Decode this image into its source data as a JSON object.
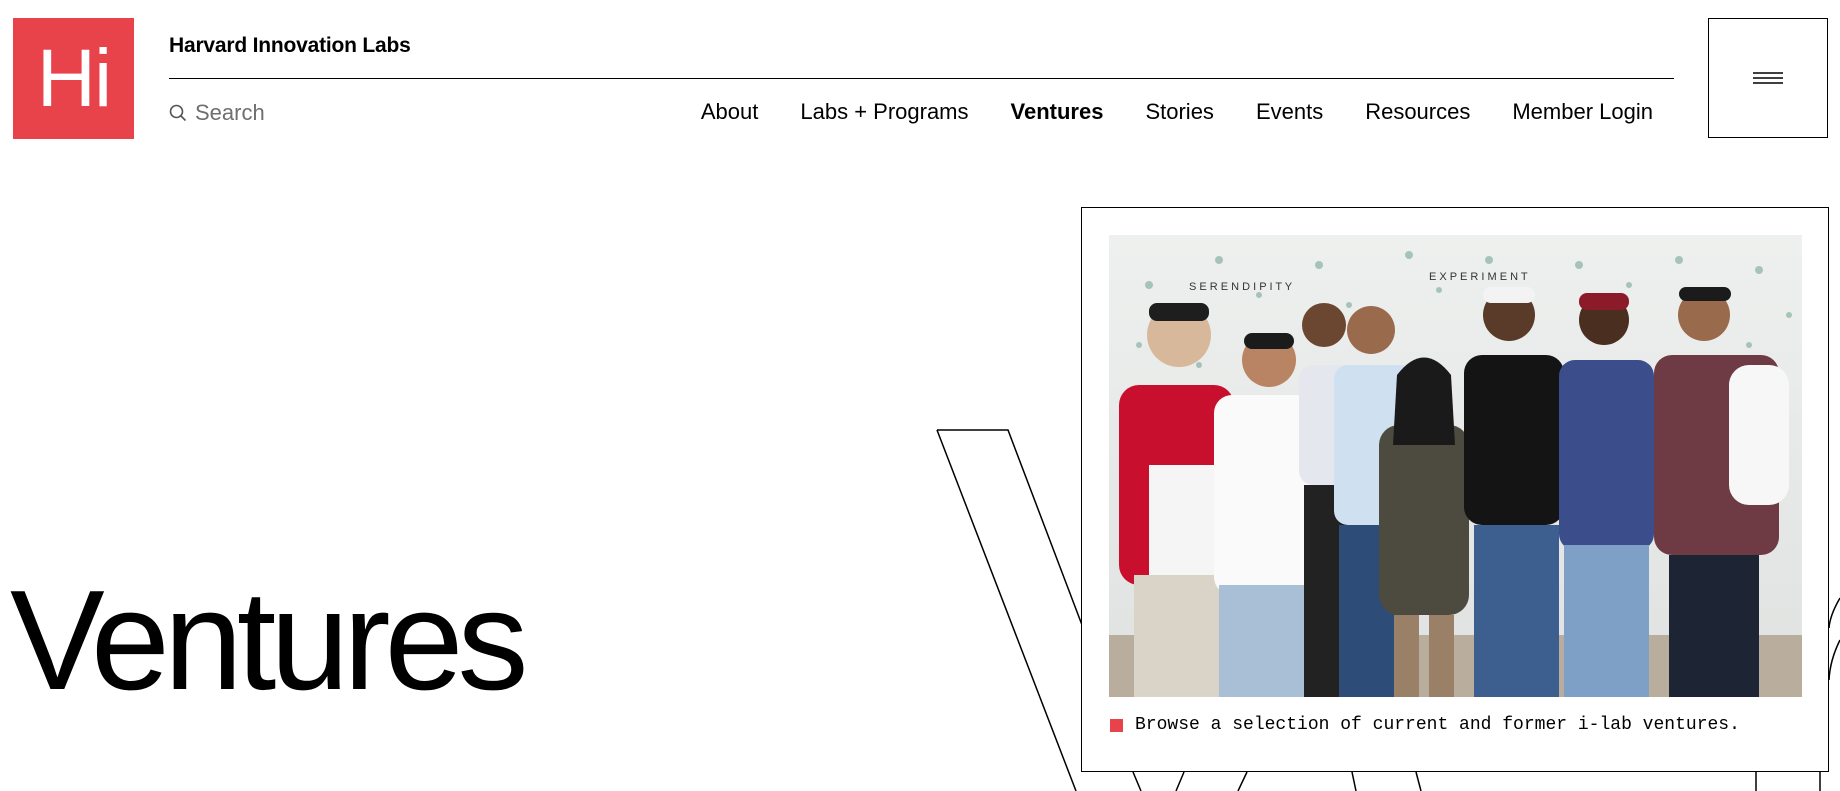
{
  "header": {
    "logo_text": "Hi",
    "brand": "Harvard Innovation Labs",
    "search_placeholder": "Search",
    "nav": [
      {
        "label": "About",
        "active": false
      },
      {
        "label": "Labs + Programs",
        "active": false
      },
      {
        "label": "Ventures",
        "active": true
      },
      {
        "label": "Stories",
        "active": false
      },
      {
        "label": "Events",
        "active": false
      },
      {
        "label": "Resources",
        "active": false
      },
      {
        "label": "Member Login",
        "active": false
      }
    ],
    "menu_icon": "hamburger-menu-icon"
  },
  "hero": {
    "title": "Ventures",
    "caption": "Browse a selection of current and former i-lab ventures.",
    "wall_letters_1": "S E R E N D I P I T Y",
    "wall_letters_2": "E X P E R I M E N T"
  },
  "colors": {
    "accent": "#e8424b",
    "text": "#000000",
    "background": "#ffffff"
  }
}
